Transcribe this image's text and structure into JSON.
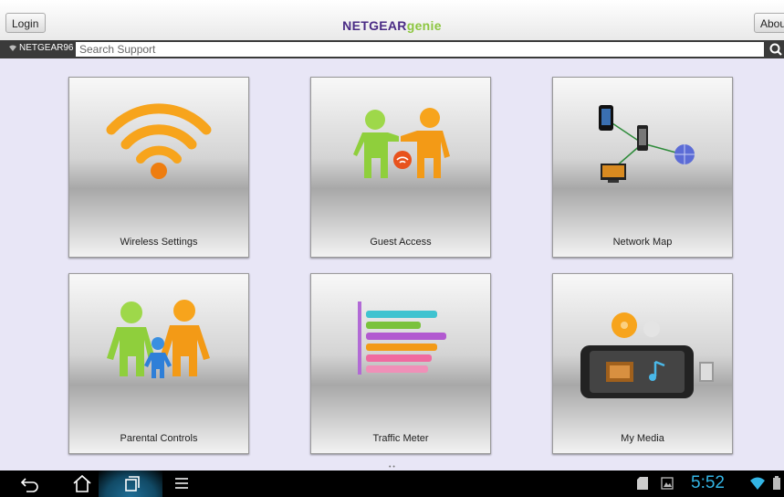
{
  "header": {
    "login_label": "Login",
    "about_label": "About",
    "brand_part1": "NETGEAR",
    "brand_part2": "genie",
    "brand_colors": {
      "netgear": "#4a2b85",
      "genie": "#8cc63f"
    }
  },
  "search": {
    "network_name": "NETGEAR96",
    "placeholder": "Search Support",
    "value": ""
  },
  "tiles": [
    {
      "label": "Wireless Settings",
      "icon": "wifi-icon"
    },
    {
      "label": "Guest Access",
      "icon": "guest-access-icon"
    },
    {
      "label": "Network Map",
      "icon": "network-map-icon"
    },
    {
      "label": "Parental Controls",
      "icon": "parental-controls-icon"
    },
    {
      "label": "Traffic Meter",
      "icon": "traffic-meter-icon"
    },
    {
      "label": "My Media",
      "icon": "my-media-icon"
    }
  ],
  "page_indicator": "• •",
  "status_bar": {
    "time": "5:52",
    "accent_color": "#33b5e5"
  },
  "colors": {
    "background": "#e8e6f6",
    "topbar": "#f2f2f2",
    "search_bar": "#3a3a3a"
  }
}
